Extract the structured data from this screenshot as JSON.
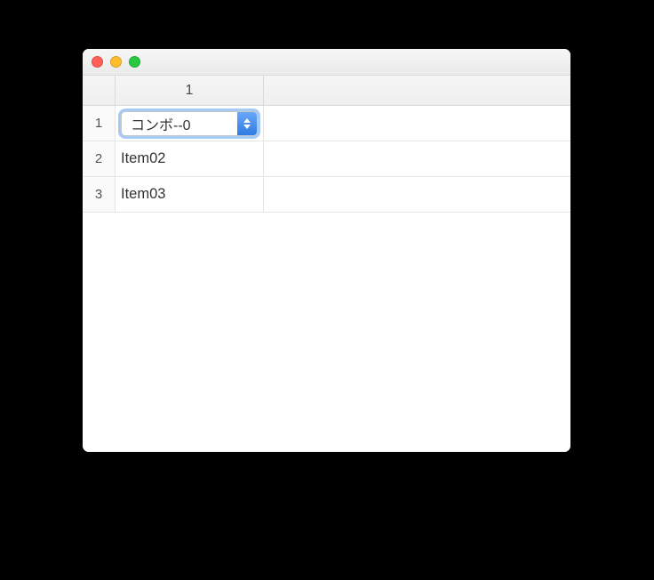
{
  "window": {
    "title": ""
  },
  "table": {
    "columns": [
      "1"
    ],
    "rows": [
      {
        "index": "1",
        "editor": "combo",
        "value": "コンボ--0"
      },
      {
        "index": "2",
        "editor": "text",
        "value": "Item02"
      },
      {
        "index": "3",
        "editor": "text",
        "value": "Item03"
      }
    ]
  },
  "colors": {
    "focus_ring": "#5c9fef",
    "combo_cap_top": "#6aa8f7",
    "combo_cap_bottom": "#2e7be4"
  }
}
